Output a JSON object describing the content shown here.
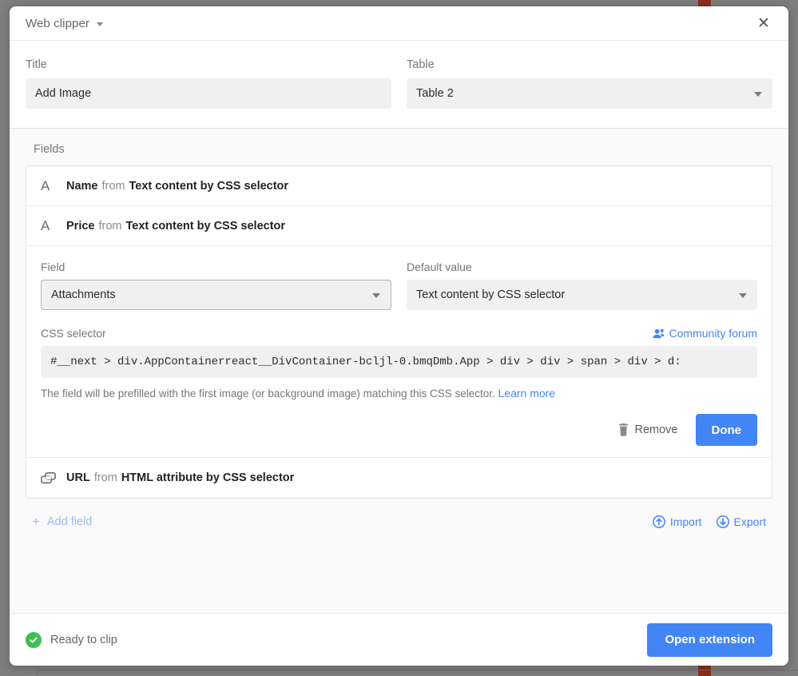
{
  "app": {
    "title": "Web clipper",
    "close_label": "✕"
  },
  "top_form": {
    "title_label": "Title",
    "title_value": "Add Image",
    "table_label": "Table",
    "table_value": "Table 2"
  },
  "fields_section": {
    "heading": "Fields",
    "rows": [
      {
        "icon": "text-field-icon",
        "name": "Name",
        "from": "from",
        "source": "Text content by CSS selector"
      },
      {
        "icon": "text-field-icon",
        "name": "Price",
        "from": "from",
        "source": "Text content by CSS selector"
      },
      {
        "icon": "attachment-field-icon",
        "name": "URL",
        "from": "from",
        "source": "HTML attribute by CSS selector"
      }
    ],
    "add_field_label": "Add field",
    "add_field_icon": "plus-icon",
    "import_label": "Import",
    "import_icon": "arrow-up-circle-icon",
    "export_label": "Export",
    "export_icon": "arrow-down-circle-icon"
  },
  "editor": {
    "field_label": "Field",
    "field_value": "Attachments",
    "default_value_label": "Default value",
    "default_value_value": "Text content by CSS selector",
    "css_selector_label": "CSS selector",
    "community_forum_label": "Community forum",
    "community_forum_icon": "people-icon",
    "css_selector_value": "#__next > div.AppContainerreact__DivContainer-bcljl-0.bmqDmb.App > div > div > span > div > d:",
    "help_text": "The field will be prefilled with the first image (or background image) matching this CSS selector.",
    "learn_more_label": "Learn more",
    "remove_label": "Remove",
    "remove_icon": "trash-icon",
    "done_label": "Done"
  },
  "footer": {
    "status_text": "Ready to clip",
    "status_icon": "check-circle-icon",
    "open_extension_label": "Open extension"
  },
  "colors": {
    "accent_blue": "#4285f4",
    "status_green": "#3fbe50",
    "muted_blue": "#9db9ef"
  }
}
